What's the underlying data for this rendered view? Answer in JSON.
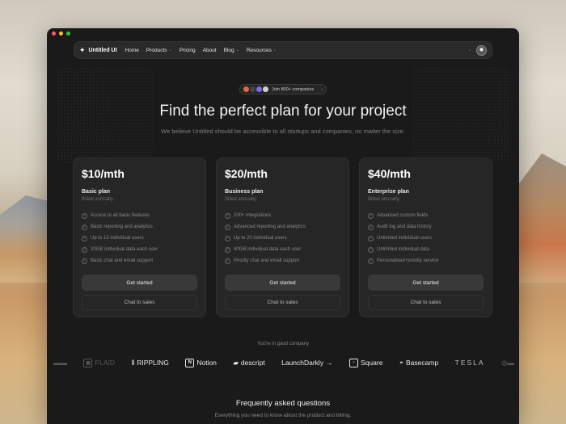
{
  "nav": {
    "brand": "Untitled UI",
    "items": [
      {
        "label": "Home",
        "dropdown": false
      },
      {
        "label": "Products",
        "dropdown": true
      },
      {
        "label": "Pricing",
        "dropdown": false
      },
      {
        "label": "About",
        "dropdown": false
      },
      {
        "label": "Blog",
        "dropdown": true
      },
      {
        "label": "Resources",
        "dropdown": true
      }
    ]
  },
  "badge": {
    "text": "Join 800+ companies",
    "arrow": "›"
  },
  "hero": {
    "title": "Find the perfect plan for your project",
    "subtitle": "We believe Untitled should be accessible to all startups and companies, no matter the size."
  },
  "plans": [
    {
      "price": "$10/mth",
      "name": "Basic plan",
      "billing": "Billed annually.",
      "features": [
        "Access to all basic features",
        "Basic reporting and analytics",
        "Up to 10 individual users",
        "20GB individual data each user",
        "Basic chat and email support"
      ],
      "primary_cta": "Get started",
      "secondary_cta": "Chat to sales"
    },
    {
      "price": "$20/mth",
      "name": "Business plan",
      "billing": "Billed annually.",
      "features": [
        "200+ integrations",
        "Advanced reporting and analytics",
        "Up to 20 individual users",
        "40GB individual data each user",
        "Priority chat and email support"
      ],
      "primary_cta": "Get started",
      "secondary_cta": "Chat to sales"
    },
    {
      "price": "$40/mth",
      "name": "Enterprise plan",
      "billing": "Billed annually.",
      "features": [
        "Advanced custom fields",
        "Audit log and data history",
        "Unlimited individual users",
        "Unlimited individual data",
        "Personalised+priotity service"
      ],
      "primary_cta": "Get started",
      "secondary_cta": "Chat to sales"
    }
  ],
  "companies": {
    "label": "You're in good company",
    "logos": [
      "PLAID",
      "RIPPLING",
      "Notion",
      "descript",
      "LaunchDarkly",
      "Square",
      "Basecamp",
      "TESLA"
    ]
  },
  "faq": {
    "title": "Frequently asked questions",
    "subtitle": "Everything you need to know about the product and billing."
  }
}
